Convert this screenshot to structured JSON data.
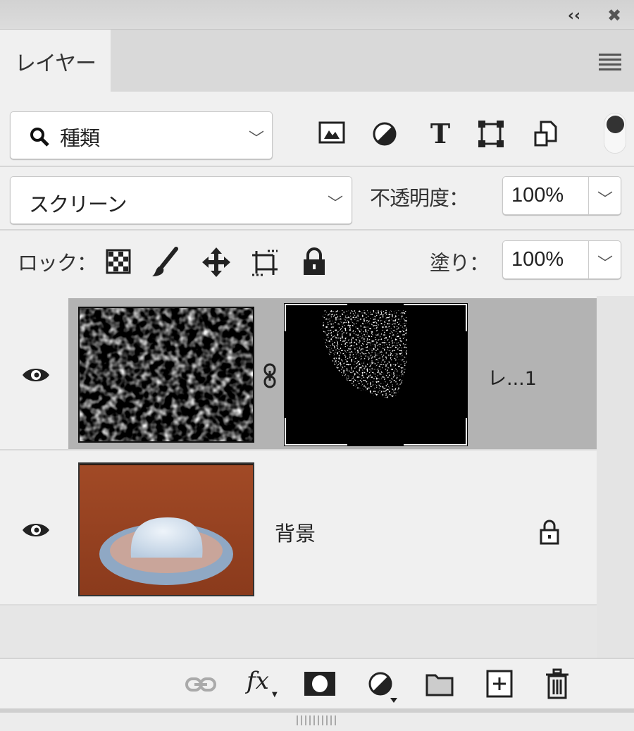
{
  "window": {
    "collapse_icon": "double-chevron-left-icon",
    "close_icon": "close-icon"
  },
  "tab": {
    "label": "レイヤー",
    "menu_icon": "hamburger-menu-icon"
  },
  "filter": {
    "value": "種類",
    "icons": [
      "pixel-layer-filter-icon",
      "adjustment-layer-filter-icon",
      "type-layer-filter-icon",
      "shape-layer-filter-icon",
      "smart-object-filter-icon"
    ]
  },
  "blend": {
    "mode": "スクリーン",
    "opacity_label": "不透明度：",
    "opacity": "100%"
  },
  "lock": {
    "label": "ロック：",
    "fill_label": "塗り：",
    "fill": "100%"
  },
  "layers": [
    {
      "name": "レ...1",
      "visible": true,
      "selected": true,
      "has_mask": true
    },
    {
      "name": "背景",
      "visible": true,
      "selected": false,
      "locked": true
    }
  ],
  "colors": {
    "panel": "#f0f0f0",
    "selected_row": "#b3b3b3",
    "tab_bar": "#d9d9d9"
  }
}
